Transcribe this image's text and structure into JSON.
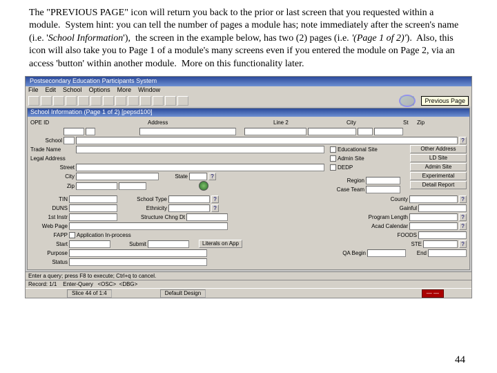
{
  "instruction": {
    "full_text": "The \"PREVIOUS PAGE\" icon will return you back to the prior or last screen that you requested within a module.  System hint: you can tell the number of pages a module has; note immediately after the screen's name (i.e. 'School Information'),  the screen in the example below, has two (2) pages (i.e. '(Page 1 of 2)').  Also, this icon will also take you to Page 1 of a module's many screens even if you entered the module on Page 2, via an access 'button' within another module.  More on this functionality later."
  },
  "app": {
    "main_title": "Postsecondary Education Participants System",
    "menus": [
      "File",
      "Edit",
      "School",
      "Options",
      "More",
      "Window"
    ],
    "tooltip": "Previous Page",
    "sub_title": "School Information  (Page 1 of 2)  [pepsd100]"
  },
  "header_fields": {
    "ope_id": "OPE ID",
    "address": "Address",
    "line2": "Line 2",
    "city": "City",
    "st": "St",
    "zip": "Zip",
    "school": "School",
    "trade_name": "Trade Name",
    "legal_address": "Legal Address",
    "street": "Street",
    "city2": "City",
    "state": "State",
    "zip2": "Zip",
    "region": "Region",
    "case_team": "Case Team"
  },
  "checkboxes": {
    "edu_site": "Educational Site",
    "admin_site": "Admin Site",
    "dedp": "DEDP"
  },
  "right_buttons": {
    "other_address": "Other Address",
    "ld_site": "LD Site",
    "admin_site": "Admin Site",
    "experimental": "Experimental",
    "detail_report": "Detail Report"
  },
  "mid_fields": {
    "tin": "TIN",
    "duns": "DUNS",
    "first_instr": "1st Instr",
    "web_page": "Web Page",
    "fapp": "FAPP",
    "school_type": "School Type",
    "ethnicity": "Ethnicity",
    "structure_chng_dt": "Structure Chng Dt",
    "app_inprocess": "Application In-process",
    "county": "County",
    "gainful": "Gainful",
    "program_length": "Program Length",
    "acad_calendar": "Acad Calendar",
    "foods": "FOODS",
    "ste": "STE"
  },
  "bottom_fields": {
    "start": "Start",
    "submit": "Submit",
    "literals_on_app": "Literals on App",
    "qa_begin": "QA Begin",
    "end": "End",
    "purpose": "Purpose",
    "status": "Status"
  },
  "statusbar": {
    "hint": "Enter a query; press F8 to execute; Ctrl+q to cancel.",
    "record": "Record: 1/1",
    "mode": "Enter-Query",
    "osc": "<OSC>",
    "dbg": "<DBG>"
  },
  "bottombar": {
    "slice": "Slice 44 of 1:4",
    "layout": "Default Design"
  },
  "page_number": "44"
}
